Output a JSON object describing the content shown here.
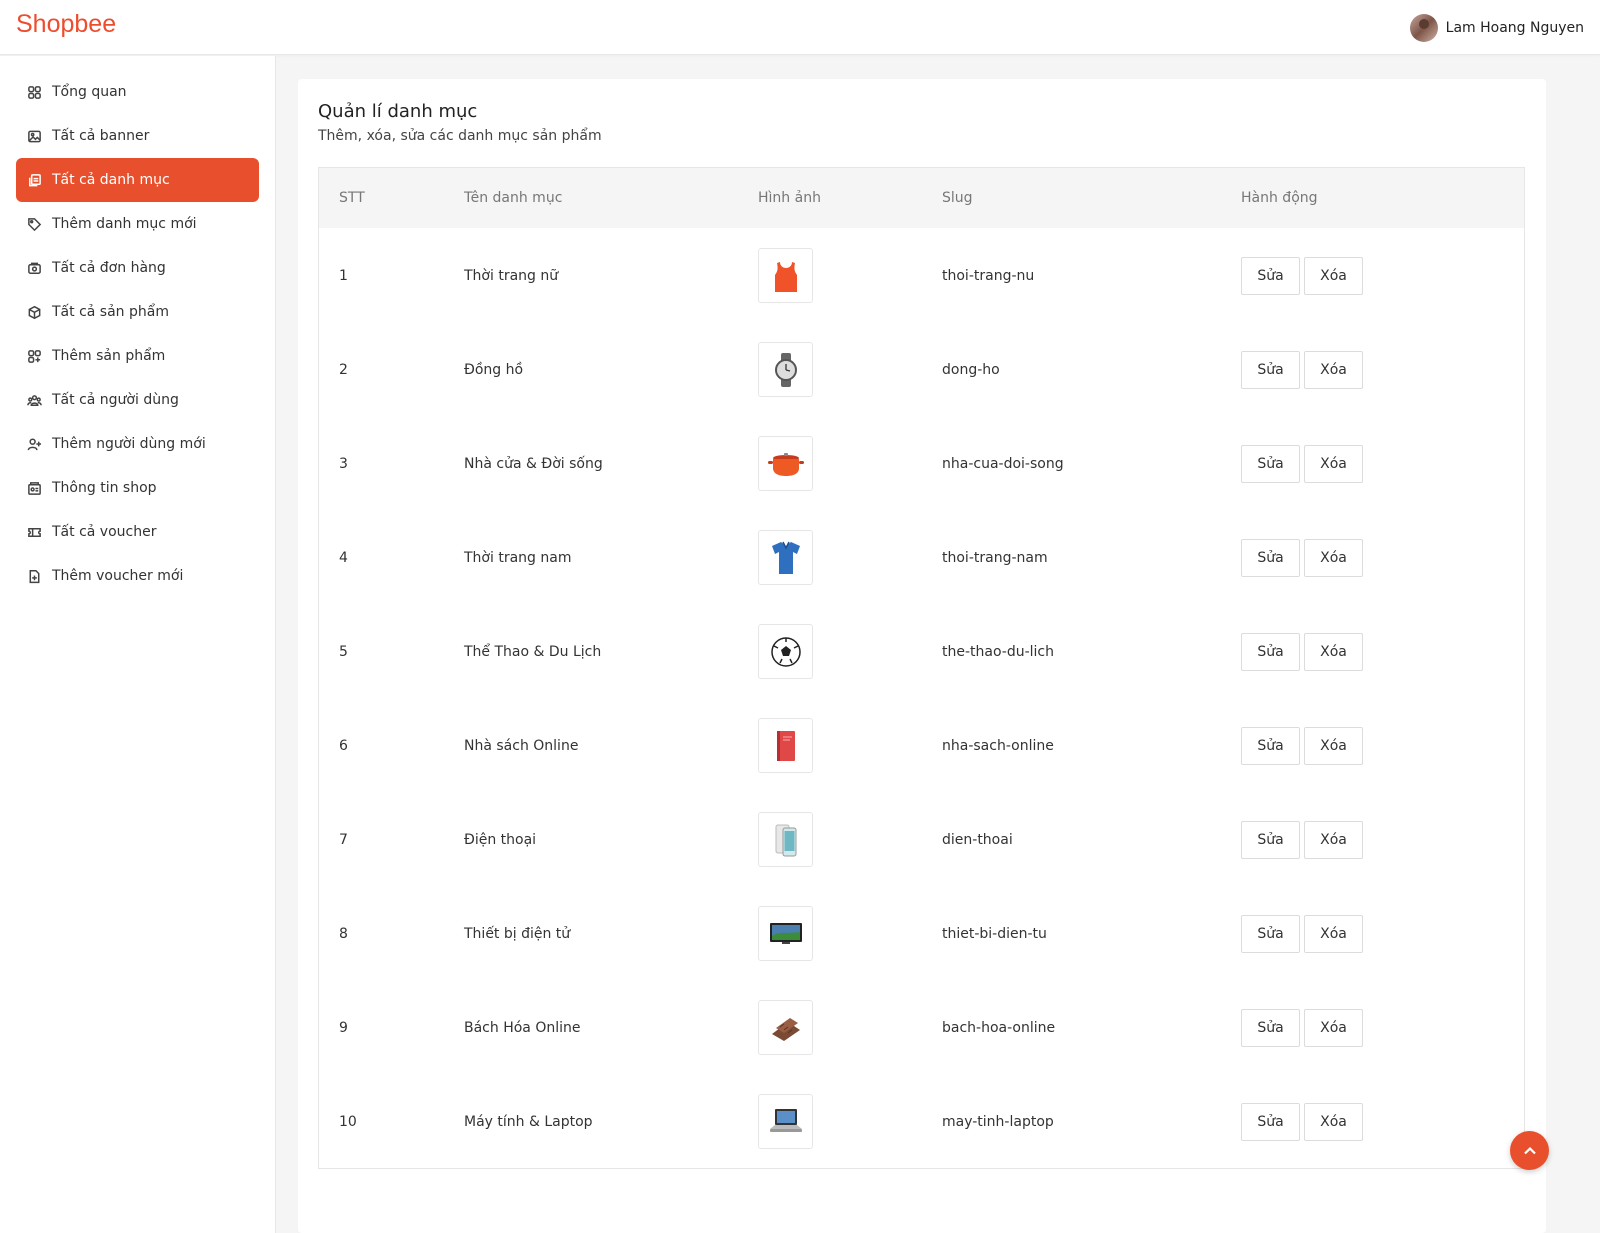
{
  "app": {
    "logo": "Shopbee",
    "brand_color": "#e8502d"
  },
  "user": {
    "name": "Lam Hoang Nguyen"
  },
  "sidebar": {
    "items": [
      {
        "label": "Tổng quan",
        "icon": "dashboard-icon"
      },
      {
        "label": "Tất cả banner",
        "icon": "image-icon"
      },
      {
        "label": "Tất cả danh mục",
        "icon": "copy-icon",
        "active": true
      },
      {
        "label": "Thêm danh mục mới",
        "icon": "tag-icon"
      },
      {
        "label": "Tất cả đơn hàng",
        "icon": "orders-icon"
      },
      {
        "label": "Tất cả sản phẩm",
        "icon": "box-icon"
      },
      {
        "label": "Thêm sản phẩm",
        "icon": "add-grid-icon"
      },
      {
        "label": "Tất cả người dùng",
        "icon": "users-icon"
      },
      {
        "label": "Thêm người dùng mới",
        "icon": "add-user-icon"
      },
      {
        "label": "Thông tin shop",
        "icon": "shop-icon"
      },
      {
        "label": "Tất cả voucher",
        "icon": "ticket-icon"
      },
      {
        "label": "Thêm voucher mới",
        "icon": "add-file-icon"
      }
    ]
  },
  "page": {
    "title": "Quản lí danh mục",
    "subtitle": "Thêm, xóa, sửa các danh mục sản phẩm"
  },
  "table": {
    "headers": [
      "STT",
      "Tên danh mục",
      "Hình ảnh",
      "Slug",
      "Hành động"
    ],
    "edit_label": "Sửa",
    "delete_label": "Xóa",
    "rows": [
      {
        "stt": "1",
        "name": "Thời trang nữ",
        "slug": "thoi-trang-nu",
        "image": "tank-top-icon"
      },
      {
        "stt": "2",
        "name": "Đồng hồ",
        "slug": "dong-ho",
        "image": "watch-icon"
      },
      {
        "stt": "3",
        "name": "Nhà cửa & Đời sống",
        "slug": "nha-cua-doi-song",
        "image": "pot-icon"
      },
      {
        "stt": "4",
        "name": "Thời trang nam",
        "slug": "thoi-trang-nam",
        "image": "polo-shirt-icon"
      },
      {
        "stt": "5",
        "name": "Thể Thao & Du Lịch",
        "slug": "the-thao-du-lich",
        "image": "soccer-ball-icon"
      },
      {
        "stt": "6",
        "name": "Nhà sách Online",
        "slug": "nha-sach-online",
        "image": "book-icon"
      },
      {
        "stt": "7",
        "name": "Điện thoại",
        "slug": "dien-thoai",
        "image": "phone-icon"
      },
      {
        "stt": "8",
        "name": "Thiết bị điện tử",
        "slug": "thiet-bi-dien-tu",
        "image": "tv-icon"
      },
      {
        "stt": "9",
        "name": "Bách Hóa Online",
        "slug": "bach-hoa-online",
        "image": "chocolate-icon"
      },
      {
        "stt": "10",
        "name": "Máy tính & Laptop",
        "slug": "may-tinh-laptop",
        "image": "laptop-icon"
      }
    ]
  }
}
